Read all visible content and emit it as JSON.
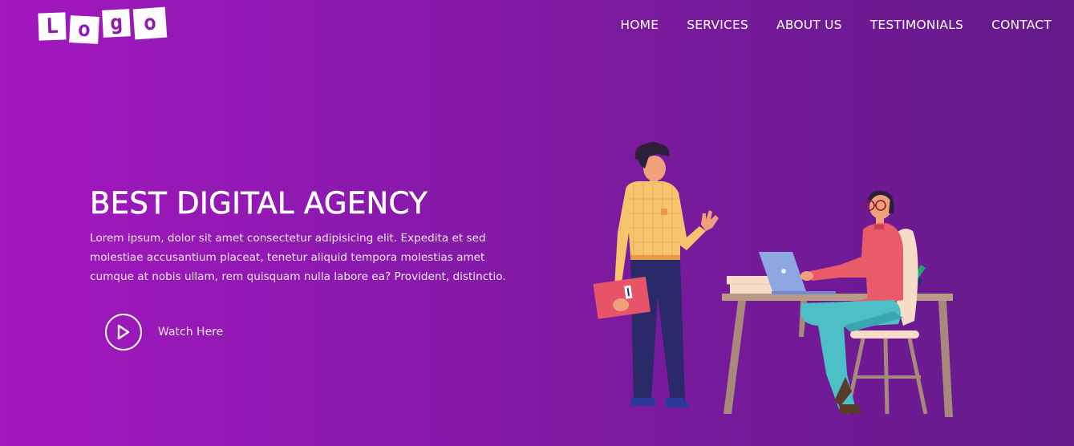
{
  "logo": {
    "letters": [
      "L",
      "o",
      "g",
      "o"
    ]
  },
  "nav": {
    "items": [
      "HOME",
      "SERVICES",
      "ABOUT US",
      "TESTIMONIALS",
      "CONTACT"
    ]
  },
  "hero": {
    "title": "BEST DIGITAL AGENCY",
    "paragraph": "Lorem ipsum, dolor sit amet consectetur adipisicing elit. Expedita et sed molestiae accusantium placeat, tenetur aliquid tempora molestias amet cumque at nobis ullam, rem quisquam nulla labore ea? Provident, distinctio.",
    "watch_label": "Watch Here"
  },
  "icons": {
    "play": "play-icon"
  },
  "colors": {
    "gradient_start": "#a318bf",
    "gradient_end": "#641b8a",
    "text": "#ffffff"
  }
}
